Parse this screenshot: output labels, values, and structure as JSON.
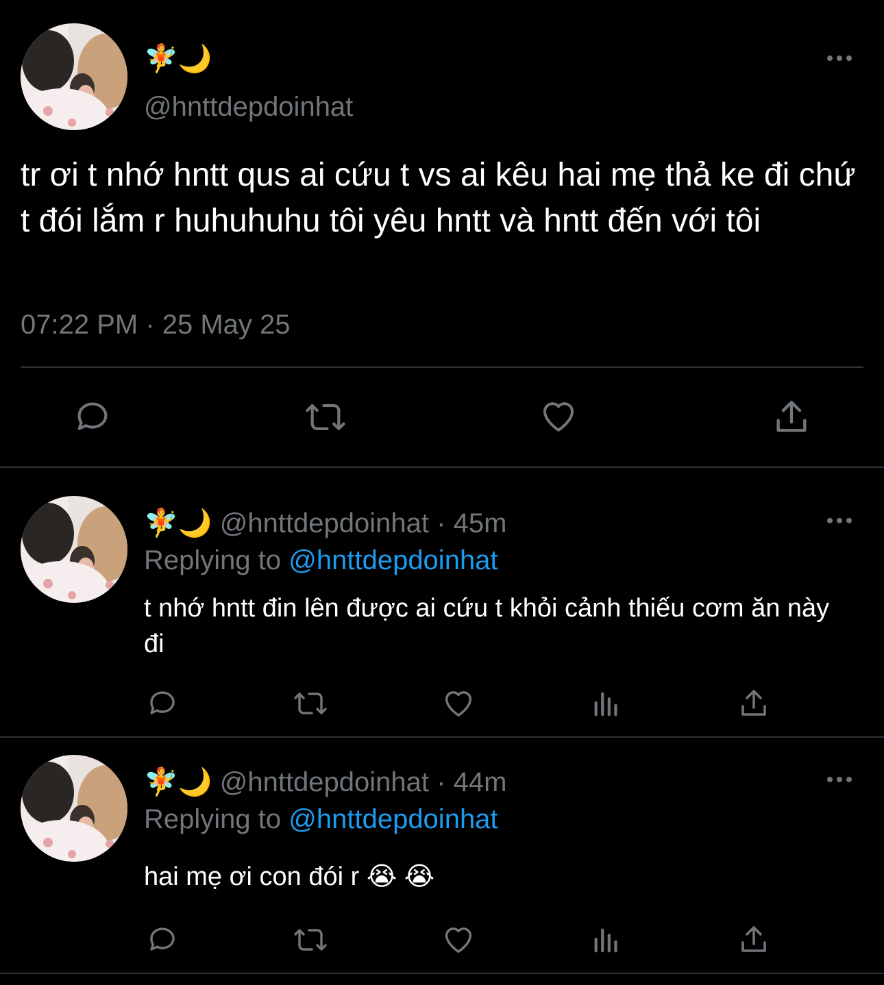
{
  "main_tweet": {
    "display_name": "🧚🌙",
    "handle": "@hnttdepdoinhat",
    "text": "tr ơi t nhớ hntt qus ai cứu t vs ai kêu hai mẹ thả ke đi chứ t đói lắm r huhuhuhu tôi yêu hntt và hntt đến với tôi",
    "timestamp": "07:22 PM · 25 May 25"
  },
  "replies": [
    {
      "display_name": "🧚🌙",
      "handle": "@hnttdepdoinhat",
      "age": "· 45m",
      "replying_prefix": "Replying to",
      "replying_handle": "@hnttdepdoinhat",
      "text": "t nhớ hntt đin lên được ai cứu t khỏi cảnh thiếu cơm ăn này đi"
    },
    {
      "display_name": "🧚🌙",
      "handle": "@hnttdepdoinhat",
      "age": "· 44m",
      "replying_prefix": "Replying to",
      "replying_handle": "@hnttdepdoinhat",
      "text": "hai mẹ ơi con đói r 😭 😭"
    }
  ],
  "icons": {
    "reply": "comment-bubble-icon",
    "retweet": "retweet-arrows-icon",
    "like": "heart-icon",
    "views": "bar-chart-icon",
    "share": "share-upload-icon",
    "more": "more-dots-icon"
  },
  "colors": {
    "background": "#000000",
    "text": "#ffffff",
    "muted": "#71767b",
    "link": "#1d9bf0",
    "divider": "#2f3336"
  }
}
